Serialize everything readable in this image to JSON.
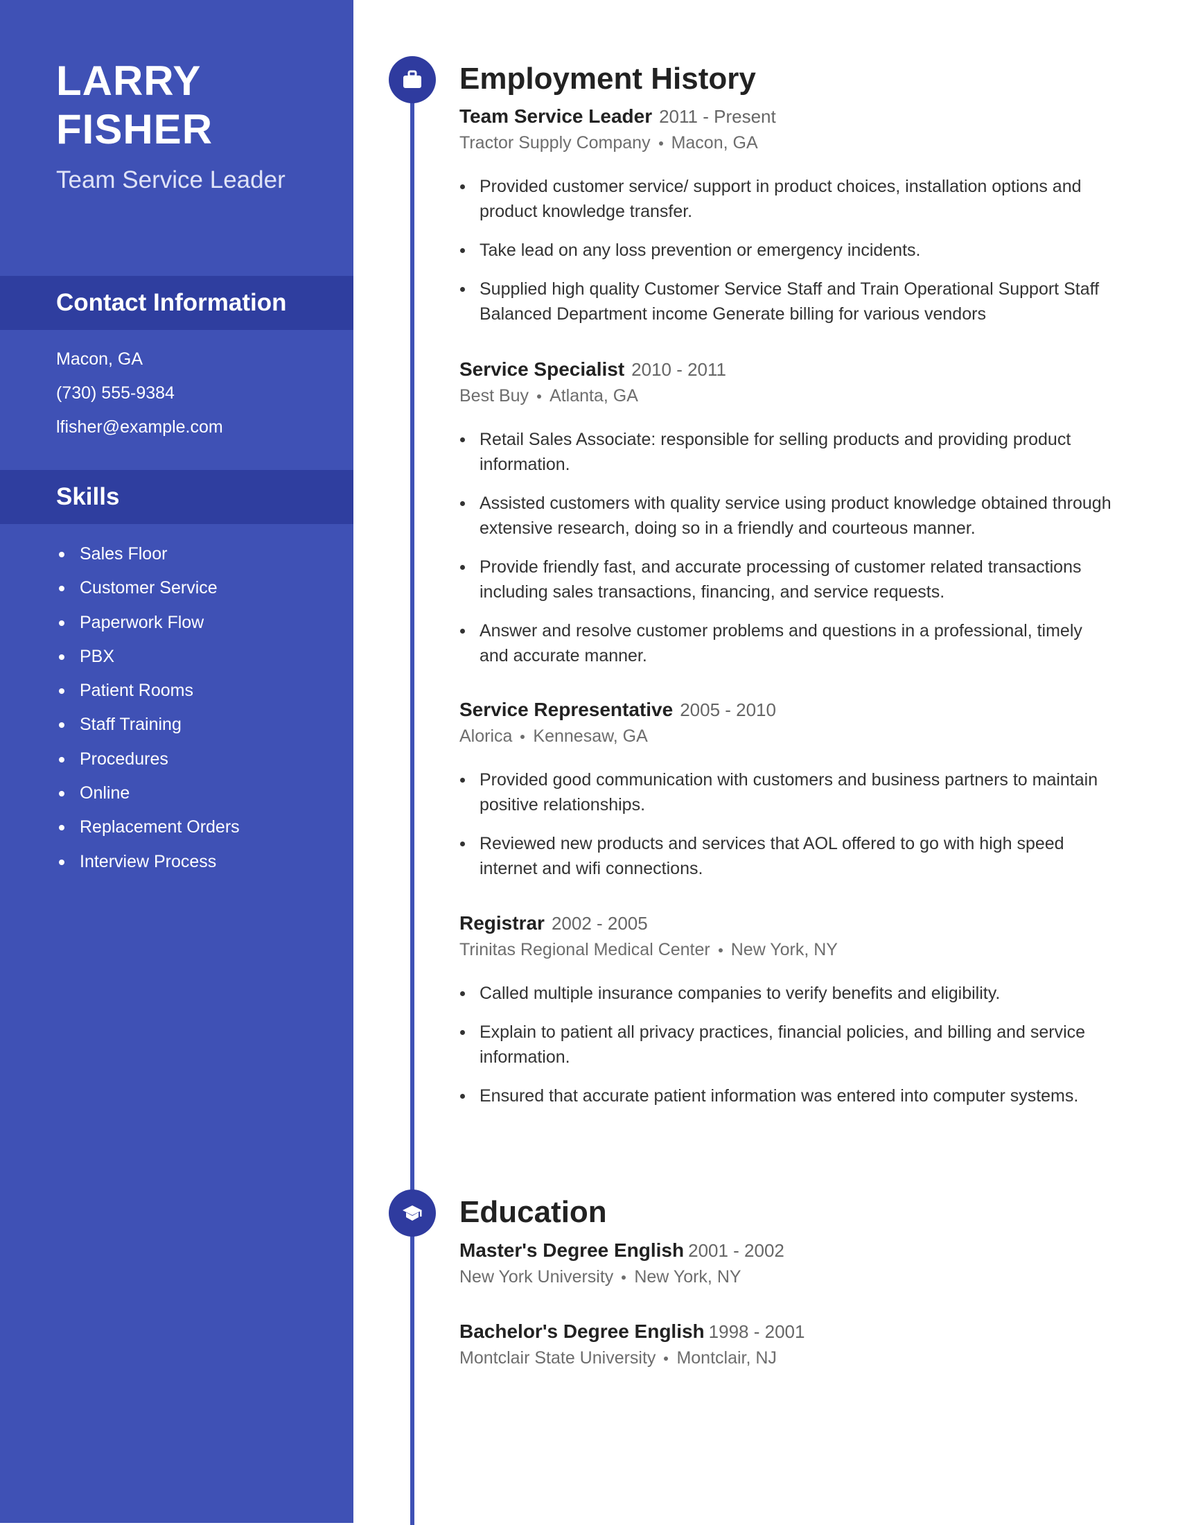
{
  "profile": {
    "first_name": "LARRY",
    "last_name": "FISHER",
    "headline": "Team Service Leader"
  },
  "contact": {
    "heading": "Contact Information",
    "items": [
      "Macon, GA",
      "(730) 555-9384",
      "lfisher@example.com"
    ]
  },
  "skills": {
    "heading": "Skills",
    "items": [
      "Sales Floor",
      "Customer Service",
      "Paperwork Flow",
      "PBX",
      "Patient Rooms",
      "Staff Training",
      "Procedures",
      "Online",
      "Replacement Orders",
      "Interview Process"
    ]
  },
  "employment": {
    "heading": "Employment History",
    "icon": "briefcase-icon",
    "jobs": [
      {
        "title": "Team Service Leader",
        "dates": "2011 - Present",
        "company": "Tractor Supply Company",
        "location": "Macon, GA",
        "bullets": [
          "Provided customer service/ support in product choices, installation options and product knowledge transfer.",
          "Take lead on any loss prevention or emergency incidents.",
          "Supplied high quality Customer Service Staff and Train Operational Support Staff Balanced Department income Generate billing for various vendors"
        ]
      },
      {
        "title": "Service Specialist",
        "dates": "2010 - 2011",
        "company": "Best Buy",
        "location": "Atlanta, GA",
        "bullets": [
          "Retail Sales Associate: responsible for selling products and providing product information.",
          "Assisted customers with quality service using product knowledge obtained through extensive research, doing so in a friendly and courteous manner.",
          "Provide friendly fast, and accurate processing of customer related transactions including sales transactions, financing, and service requests.",
          "Answer and resolve customer problems and questions in a professional, timely and accurate manner."
        ]
      },
      {
        "title": "Service Representative",
        "dates": "2005 - 2010",
        "company": "Alorica",
        "location": "Kennesaw, GA",
        "bullets": [
          "Provided good communication with customers and business partners to maintain positive relationships.",
          "Reviewed new products and services that AOL offered to go with high speed internet and wifi connections."
        ]
      },
      {
        "title": "Registrar",
        "dates": "2002 - 2005",
        "company": "Trinitas Regional Medical Center",
        "location": "New York, NY",
        "bullets": [
          "Called multiple insurance companies to verify benefits and eligibility.",
          "Explain to patient all privacy practices, financial policies, and billing and service information.",
          "Ensured that accurate patient information was entered into computer systems."
        ]
      }
    ]
  },
  "education": {
    "heading": "Education",
    "icon": "graduation-cap-icon",
    "degrees": [
      {
        "title": "Master's Degree English",
        "dates": "2001 - 2002",
        "school": "New York University",
        "location": "New York, NY"
      },
      {
        "title": "Bachelor's Degree English",
        "dates": "1998 - 2001",
        "school": "Montclair State University",
        "location": "Montclair, NJ"
      }
    ]
  },
  "colors": {
    "sidebar": "#3f51b5",
    "sidebar_band": "#2f3e9f",
    "icon_circle": "#2f3b9f",
    "timeline": "#3f51b5"
  }
}
